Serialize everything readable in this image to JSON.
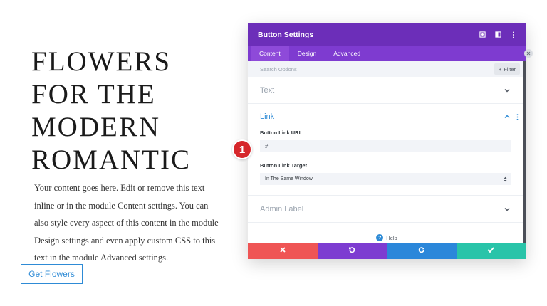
{
  "page": {
    "title_lines": [
      "FLOWERS",
      "FOR THE",
      "MODERN",
      "ROMANTIC"
    ],
    "body_text": "Your content goes here. Edit or remove this text inline or in the module Content settings. You can also style every aspect of this content in the module Design settings and even apply custom CSS to this text in the module Advanced settings.",
    "button_label": "Get Flowers"
  },
  "modal": {
    "title": "Button Settings",
    "tabs": [
      {
        "label": "Content",
        "active": true
      },
      {
        "label": "Design",
        "active": false
      },
      {
        "label": "Advanced",
        "active": false
      }
    ],
    "search_placeholder": "Search Options",
    "filter_label": "Filter",
    "sections": {
      "text": {
        "title": "Text"
      },
      "link": {
        "title": "Link",
        "url_label": "Button Link URL",
        "url_value": "#",
        "target_label": "Button Link Target",
        "target_value": "In The Same Window"
      },
      "admin": {
        "title": "Admin Label"
      }
    },
    "help_label": "Help"
  },
  "annotation": {
    "step_number": "1"
  },
  "colors": {
    "header": "#6c2eb9",
    "tabs": "#7e3bd0",
    "accent_blue": "#2e8bd6",
    "cancel": "#ef5555",
    "undo": "#7d3cd1",
    "redo": "#2b87da",
    "save": "#29c4a9",
    "badge": "#d6272b"
  },
  "icons": {
    "header": [
      "target-icon",
      "columns-icon",
      "more-vertical-icon"
    ],
    "footer": [
      "close-icon",
      "undo-icon",
      "redo-icon",
      "check-icon"
    ]
  }
}
